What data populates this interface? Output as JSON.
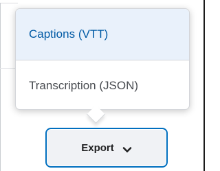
{
  "menu": {
    "items": [
      {
        "label": "Captions (VTT)",
        "selected": true
      },
      {
        "label": "Transcription (JSON)",
        "selected": false
      }
    ]
  },
  "export_button": {
    "label": "Export",
    "icon": "chevron-down-icon"
  },
  "colors": {
    "accent": "#006fbf",
    "selected_text": "#005aa5",
    "selected_bg": "#e9f1fb",
    "button_bg": "#f0f2f5"
  }
}
